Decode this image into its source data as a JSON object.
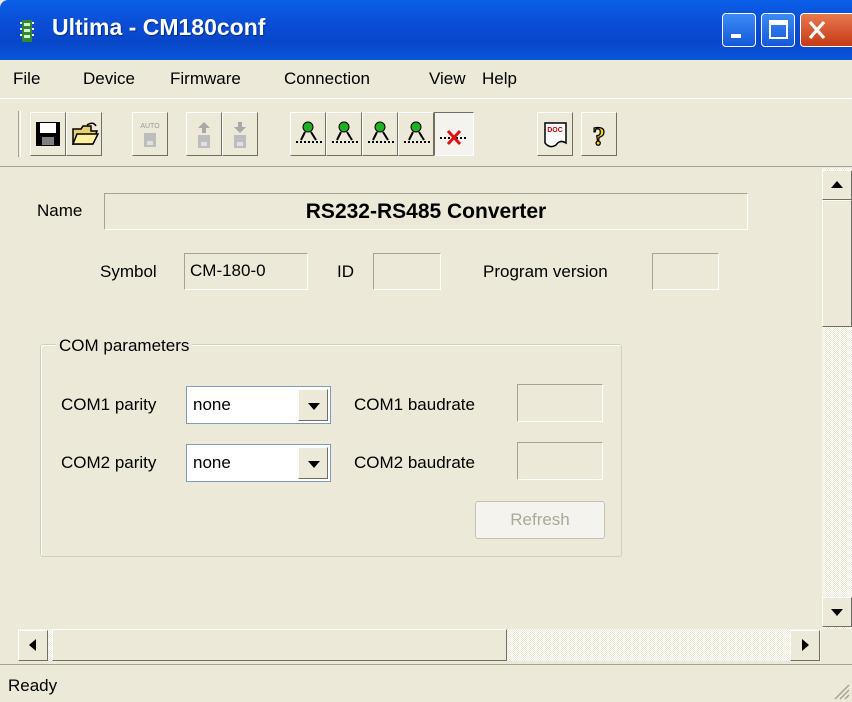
{
  "window": {
    "title": "Ultima - CM180conf",
    "buttons": [
      "minimize",
      "maximize",
      "close"
    ]
  },
  "menu": [
    "File",
    "Device",
    "Firmware",
    "Connection",
    "View",
    "Help"
  ],
  "toolbar": {
    "items": [
      {
        "icon": "save-icon",
        "enabled": true
      },
      {
        "icon": "open-folder-icon",
        "enabled": true
      },
      {
        "icon": "auto-icon",
        "enabled": false,
        "label": "AUTO"
      },
      {
        "icon": "upload-icon",
        "enabled": false
      },
      {
        "icon": "download-icon",
        "enabled": false
      },
      {
        "icon": "connect-1-icon",
        "enabled": true
      },
      {
        "icon": "connect-2-icon",
        "enabled": true
      },
      {
        "icon": "connect-3-icon",
        "enabled": true
      },
      {
        "icon": "connect-4-icon",
        "enabled": true
      },
      {
        "icon": "disconnect-icon",
        "enabled": true,
        "pressed": true
      },
      {
        "icon": "doc-icon",
        "enabled": true,
        "label": "DOC"
      },
      {
        "icon": "help-icon",
        "enabled": true
      }
    ]
  },
  "device": {
    "name_label": "Name",
    "name_value": "RS232-RS485 Converter",
    "symbol_label": "Symbol",
    "symbol_value": "CM-180-0",
    "id_label": "ID",
    "id_value": "",
    "program_version_label": "Program version",
    "program_version_value": ""
  },
  "com_parameters": {
    "legend": "COM parameters",
    "com1_parity_label": "COM1 parity",
    "com1_parity_value": "none",
    "com2_parity_label": "COM2 parity",
    "com2_parity_value": "none",
    "com1_baudrate_label": "COM1 baudrate",
    "com1_baudrate_value": "",
    "com2_baudrate_label": "COM2 baudrate",
    "com2_baudrate_value": "",
    "refresh_label": "Refresh"
  },
  "status": {
    "text": "Ready"
  },
  "colors": {
    "titlebar": "#0a4fd8",
    "face": "#ece9d8",
    "close_button": "#c43a15",
    "disabled_text": "#aca899"
  }
}
